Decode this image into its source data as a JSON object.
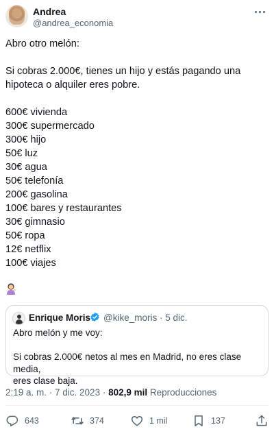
{
  "author": {
    "name": "Andrea",
    "handle": "@andrea_economia"
  },
  "tweet": {
    "lines": [
      "Abro otro melón:",
      "",
      "Si cobras 2.000€, tienes un hijo y estás pagando una",
      "hipoteca o alquiler eres pobre.",
      "",
      "600€ vivienda",
      "300€ supermercado",
      "300€ hijo",
      "50€ luz",
      "30€ agua",
      "50€ telefonía",
      "200€ gasolina",
      "100€ bares y restaurantes",
      "30€ gimnasio",
      "50€ ropa",
      "12€ netflix",
      "100€ viajes"
    ],
    "emoji_icon": "woman-tipping-hand-emoji"
  },
  "quoted": {
    "name": "Enrique Moris",
    "handle_time": "@kike_moris · 5 dic.",
    "lines": [
      "Abro melón y me voy:",
      "",
      "Si cobras 2.000€ netos al mes en Madrid, no eres clase media,",
      "eres clase baja."
    ],
    "verified_color": "#1d9bf0"
  },
  "meta": {
    "timestamp": "2:19 a. m. · 7 dic. 2023 · ",
    "views_count": "802,9 mil",
    "views_label": " Reproducciones"
  },
  "actions": {
    "replies": "643",
    "reposts": "374",
    "likes": "1 mil",
    "bookmarks": "137"
  },
  "colors": {
    "text": "#0f1419",
    "secondary": "#536471",
    "border": "#cfd9de"
  }
}
